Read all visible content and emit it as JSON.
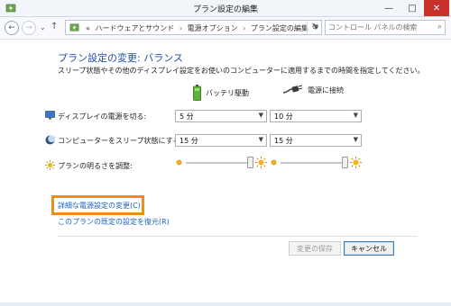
{
  "window": {
    "title": "プラン設定の編集",
    "controls": {
      "minimize": "—",
      "maximize": "□",
      "close": "✕"
    }
  },
  "nav": {
    "back_glyph": "←",
    "forward_glyph": "→",
    "recent_glyph": "⌄",
    "up_glyph": "↑",
    "address_prefix": "«",
    "breadcrumbs": [
      "ハードウェアとサウンド",
      "電源オプション",
      "プラン設定の編集"
    ],
    "separator": "›",
    "refresh_glyph": "↻",
    "search_placeholder": "コントロール パネルの検索",
    "search_glyph": "⌕"
  },
  "plan": {
    "heading": "プラン設定の変更: バランス",
    "description": "スリープ状態やその他のディスプレイ設定をお使いのコンピューターに適用するまでの時間を指定してください。",
    "columns": {
      "battery": "バッテリ駆動",
      "plugged": "電源に接続"
    },
    "rows": [
      {
        "label": "ディスプレイの電源を切る:",
        "battery": "5 分",
        "plugged": "10 分"
      },
      {
        "label": "コンピューターをスリープ状態にする:",
        "battery": "15 分",
        "plugged": "15 分"
      }
    ],
    "brightness": {
      "label": "プランの明るさを調整:",
      "battery_level": 1.0,
      "plugged_level": 1.0
    },
    "links": {
      "advanced": "詳細な電源設定の変更(C)",
      "restore": "このプランの既定の設定を復元(R)"
    },
    "buttons": {
      "save": "変更の保存",
      "cancel": "キャンセル"
    }
  },
  "colors": {
    "heading": "#1e4f9c",
    "link": "#1c60c2",
    "highlight": "#f08b1d",
    "close_button": "#c7312a"
  },
  "icons": {
    "title": "power-options-icon",
    "battery": "battery-icon",
    "plug": "power-plug-icon",
    "display": "monitor-icon",
    "sleep": "moon-icon",
    "brightness": "sun-icon"
  }
}
